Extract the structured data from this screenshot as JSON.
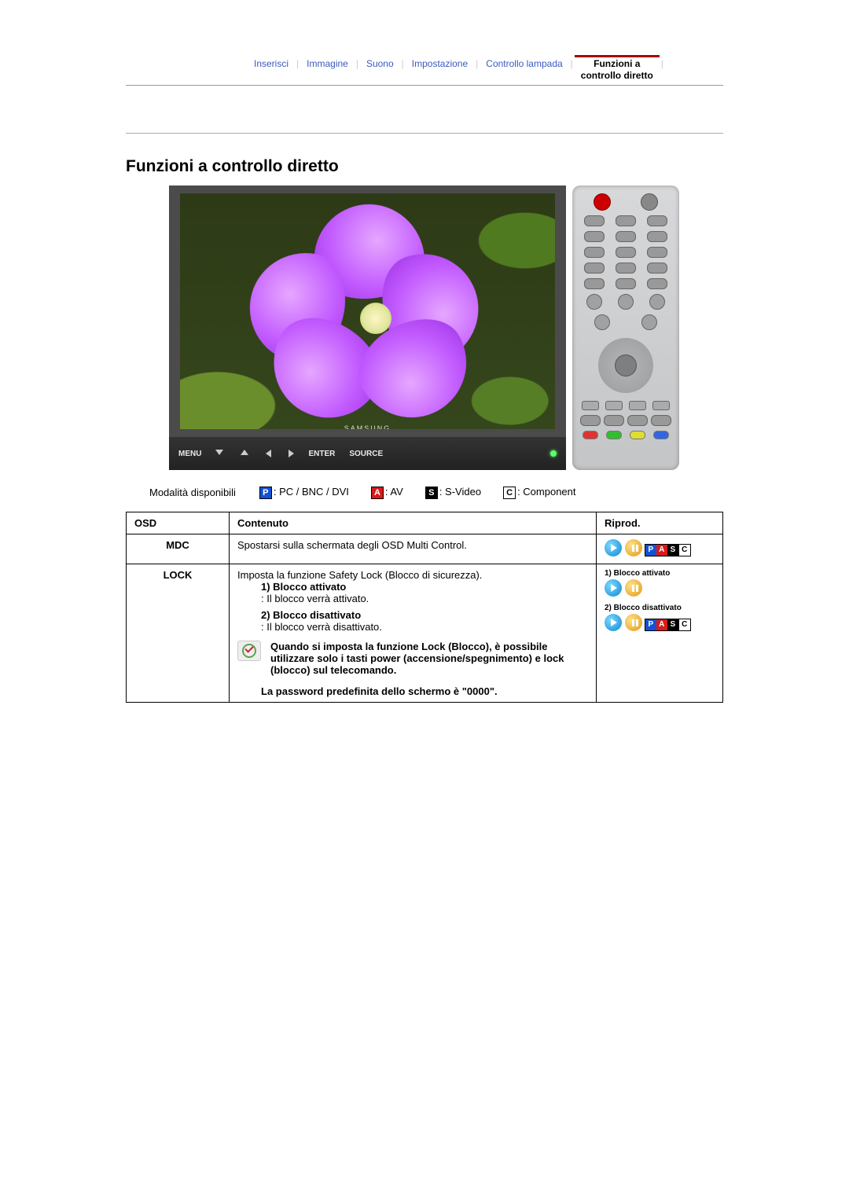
{
  "tabs": {
    "items": [
      "Inserisci",
      "Immagine",
      "Suono",
      "Impostazione",
      "Controllo lampada"
    ],
    "active": "Funzioni a\ncontrollo diretto"
  },
  "section_title": "Funzioni a controllo diretto",
  "monitor": {
    "brand": "SAMSUNG",
    "buttons": {
      "menu": "MENU",
      "enter": "ENTER",
      "source": "SOURCE"
    }
  },
  "legend": {
    "label": "Modalità disponibili",
    "P": ": PC / BNC / DVI",
    "A": ": AV",
    "S": ": S-Video",
    "C": ": Component"
  },
  "table": {
    "headers": {
      "osd": "OSD",
      "content": "Contenuto",
      "riprod": "Riprod."
    },
    "rows": [
      {
        "osd": "MDC",
        "content": {
          "line1": "Spostarsi sulla schermata degli OSD Multi Control."
        },
        "riprod": {
          "type": "pasc"
        }
      },
      {
        "osd": "LOCK",
        "content": {
          "intro": "Imposta la funzione Safety Lock (Blocco di sicurezza).",
          "opt1_title": "1) Blocco attivato",
          "opt1_desc": ": Il blocco verrà attivato.",
          "opt2_title": "2) Blocco disattivato",
          "opt2_desc": ": Il blocco verrà disattivato.",
          "note": "Quando si imposta la funzione Lock (Blocco), è possibile utilizzare solo i tasti power (accensione/spegnimento) e lock (blocco) sul telecomando.",
          "password": "La password predefinita dello schermo è \"0000\"."
        },
        "riprod": {
          "lab1": "1) Blocco attivato",
          "lab2": "2) Blocco disattivato"
        }
      }
    ]
  },
  "pasc_letters": {
    "P": "P",
    "A": "A",
    "S": "S",
    "C": "C"
  }
}
